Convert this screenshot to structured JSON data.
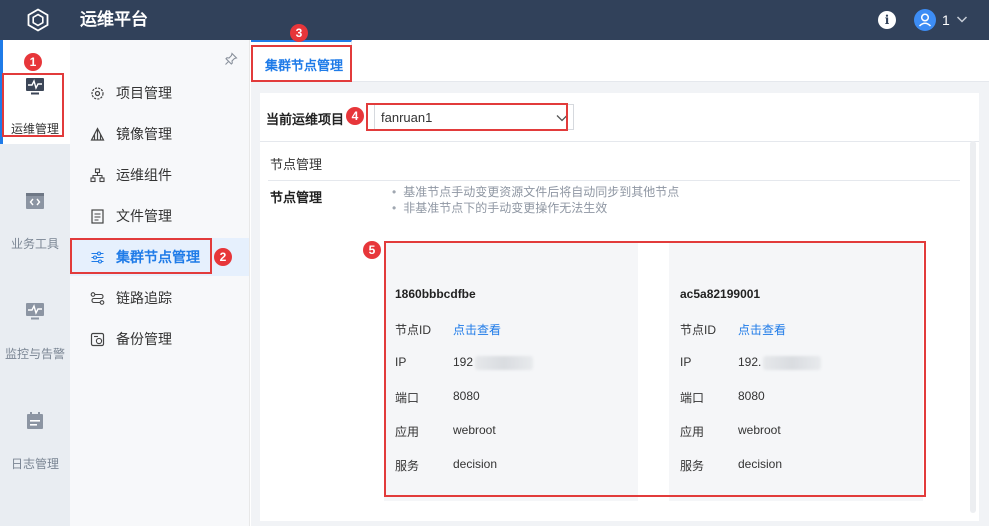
{
  "topbar": {
    "title": "运维平台",
    "info_icon": "info-icon",
    "user_name": "1"
  },
  "rail": {
    "items": [
      {
        "label": "运维管理",
        "icon": "monitor-pulse-icon",
        "active": true
      },
      {
        "label": "业务工具",
        "icon": "code-window-icon",
        "active": false
      },
      {
        "label": "监控与告警",
        "icon": "monitor-pulse-icon",
        "active": false
      },
      {
        "label": "日志管理",
        "icon": "calendar-list-icon",
        "active": false
      }
    ]
  },
  "menu": {
    "items": [
      {
        "label": "项目管理",
        "icon": "gear-icon",
        "active": false
      },
      {
        "label": "镜像管理",
        "icon": "prism-icon",
        "active": false
      },
      {
        "label": "运维组件",
        "icon": "tree-nodes-icon",
        "active": false
      },
      {
        "label": "文件管理",
        "icon": "document-icon",
        "active": false
      },
      {
        "label": "集群节点管理",
        "icon": "sliders-icon",
        "active": true
      },
      {
        "label": "链路追踪",
        "icon": "trace-icon",
        "active": false
      },
      {
        "label": "备份管理",
        "icon": "backup-icon",
        "active": false
      }
    ]
  },
  "tabs": [
    {
      "label": "集群节点管理",
      "active": true
    }
  ],
  "project": {
    "label": "当前运维项目",
    "value": "fanruan1"
  },
  "node_section": {
    "title": "节点管理",
    "label": "节点管理",
    "notes": [
      "基准节点手动变更资源文件后将自动同步到其他节点",
      "非基准节点下的手动变更操作无法生效"
    ]
  },
  "nodes": [
    {
      "name": "1860bbbcdfbe",
      "id_label": "节点ID",
      "id_link": "点击查看",
      "ip_label": "IP",
      "ip_value": "192",
      "port_label": "端口",
      "port": "8080",
      "app_label": "应用",
      "app": "webroot",
      "service_label": "服务",
      "service": "decision"
    },
    {
      "name": "ac5a82199001",
      "id_label": "节点ID",
      "id_link": "点击查看",
      "ip_label": "IP",
      "ip_value": "192.",
      "port_label": "端口",
      "port": "8080",
      "app_label": "应用",
      "app": "webroot",
      "service_label": "服务",
      "service": "decision"
    }
  ],
  "annotations": [
    "1",
    "2",
    "3",
    "4",
    "5"
  ],
  "colors": {
    "topbar": "#31415a",
    "accent": "#1f7be8",
    "annotation_red": "#e23b3b"
  }
}
